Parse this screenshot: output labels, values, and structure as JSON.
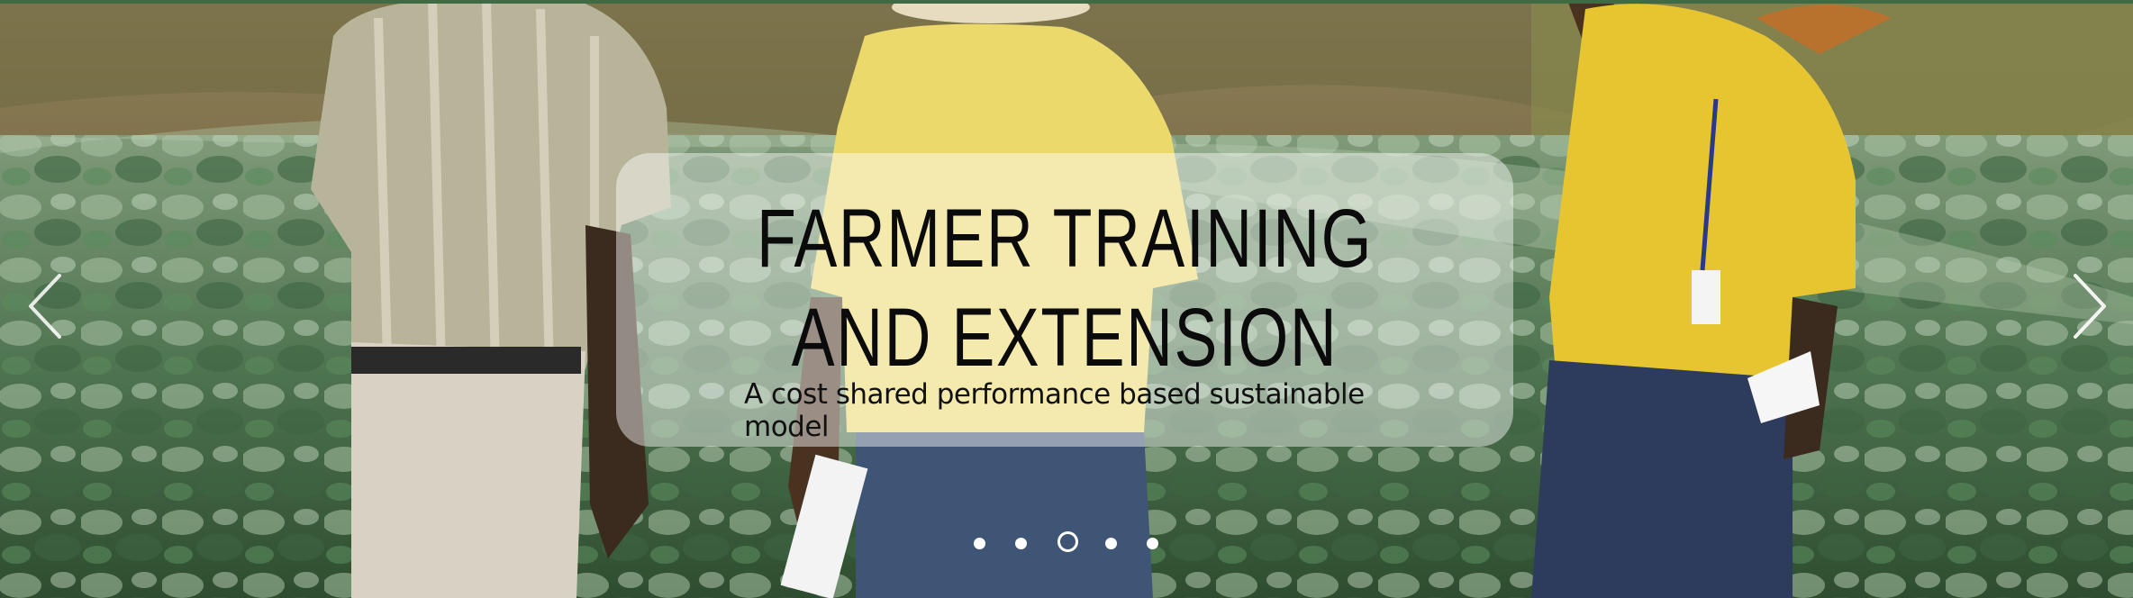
{
  "slide": {
    "title": "FARMER TRAINING AND EXTENSION",
    "subtitle": "A cost shared performance based sustainable model"
  },
  "carousel": {
    "total_slides": 5,
    "active_index": 2,
    "prev_icon": "chevron-left-icon",
    "next_icon": "chevron-right-icon"
  },
  "colors": {
    "top_border": "#3f6a44",
    "caption_background": "rgba(255,255,255,0.45)",
    "title_text": "#0b0b0b",
    "dots": "#ffffff"
  }
}
